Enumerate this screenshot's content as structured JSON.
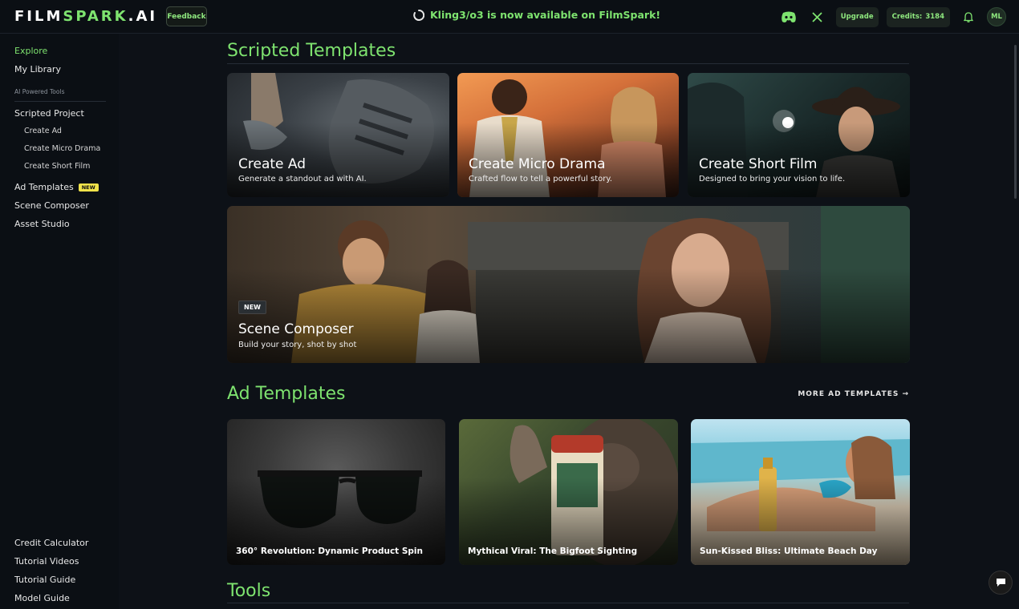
{
  "topbar": {
    "logo_part1": "FILM",
    "logo_part2": "SPARK",
    "logo_part3": ".AI",
    "feedback_label": "Feedback",
    "announcement": "Kling3/o3 is now available on FilmSpark!",
    "upgrade_label": "Upgrade",
    "credits_label": "Credits:",
    "credits_value": "3184",
    "avatar_initials": "ML"
  },
  "sidebar": {
    "explore": "Explore",
    "my_library": "My Library",
    "section_label": "AI Powered Tools",
    "scripted_project": "Scripted Project",
    "create_ad": "Create Ad",
    "create_micro_drama": "Create Micro Drama",
    "create_short_film": "Create Short Film",
    "ad_templates": "Ad Templates",
    "ad_templates_badge": "NEW",
    "scene_composer": "Scene Composer",
    "asset_studio": "Asset Studio",
    "credit_calculator": "Credit Calculator",
    "tutorial_videos": "Tutorial Videos",
    "tutorial_guide": "Tutorial Guide",
    "model_guide": "Model Guide"
  },
  "scripted": {
    "title": "Scripted Templates",
    "cards": [
      {
        "title": "Create Ad",
        "subtitle": "Generate a standout ad with AI."
      },
      {
        "title": "Create Micro Drama",
        "subtitle": "Crafted flow to tell a powerful story."
      },
      {
        "title": "Create Short Film",
        "subtitle": "Designed to bring your vision to life."
      }
    ],
    "feature": {
      "badge": "NEW",
      "title": "Scene Composer",
      "subtitle": "Build your story, shot by shot"
    }
  },
  "ad_templates": {
    "title": "Ad Templates",
    "more_link": "MORE AD TEMPLATES →",
    "cards": [
      {
        "label": "360° Revolution: Dynamic Product Spin"
      },
      {
        "label": "Mythical Viral: The Bigfoot Sighting"
      },
      {
        "label": "Sun-Kissed Bliss: Ultimate Beach Day"
      }
    ]
  },
  "tools": {
    "title": "Tools"
  },
  "colors": {
    "accent": "#7ee36f",
    "background": "#0d1117",
    "badge_yellow": "#f0e24a"
  }
}
